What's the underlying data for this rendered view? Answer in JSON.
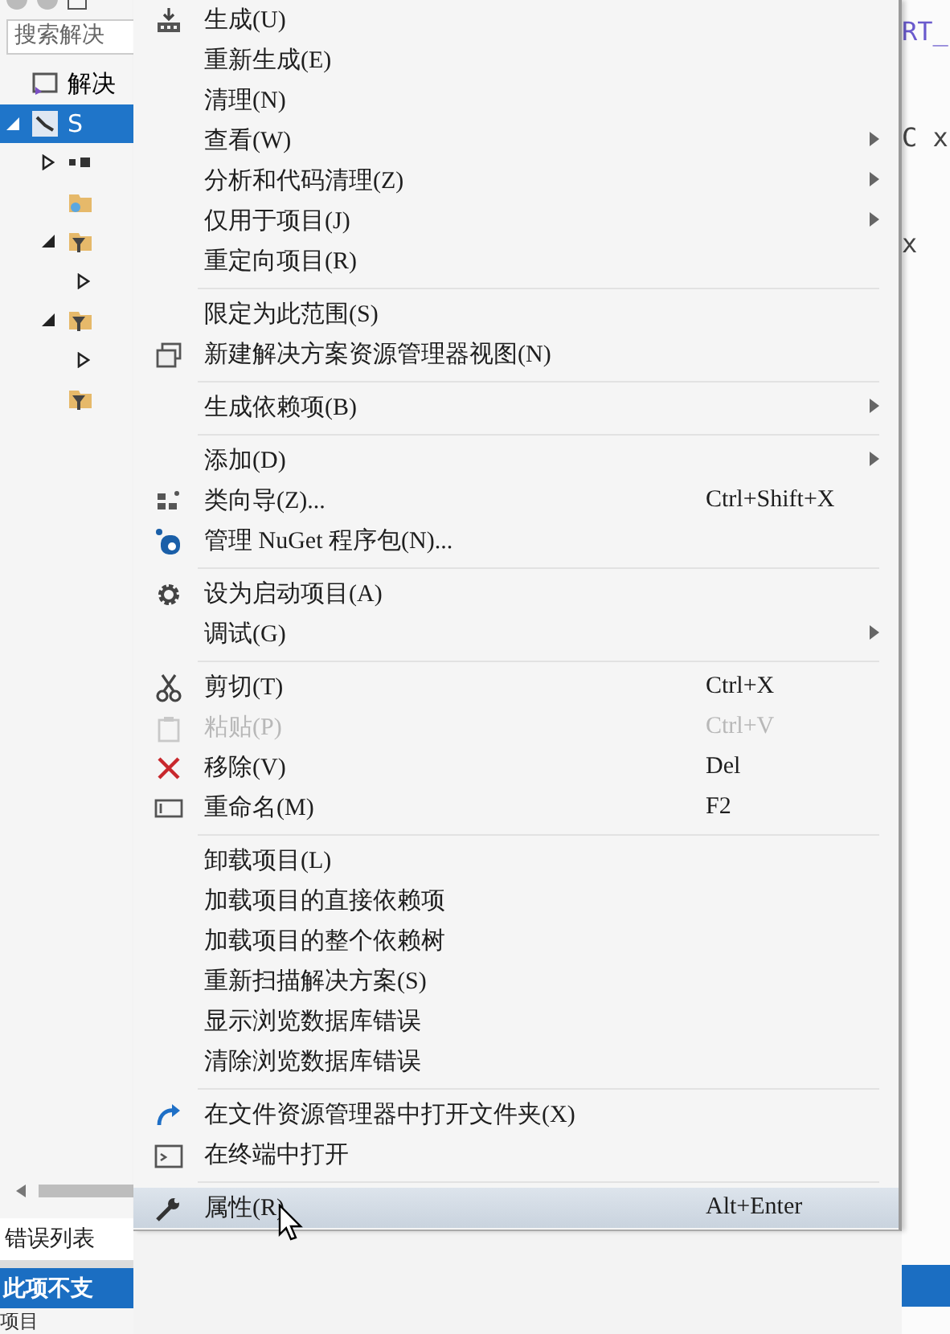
{
  "solution_explorer": {
    "search": {
      "placeholder": "搜索解决"
    },
    "tree": [
      {
        "kind": "solution",
        "label": "解决",
        "selected": false
      },
      {
        "kind": "project",
        "label": "S",
        "selected": true,
        "expanded": true,
        "children": [
          {
            "kind": "reference",
            "selected": false,
            "expanded": false
          },
          {
            "kind": "file",
            "selected": false
          },
          {
            "kind": "filter",
            "selected": false,
            "expanded": true,
            "children": [
              {
                "selected": false,
                "expanded": false
              }
            ]
          },
          {
            "kind": "filter",
            "selected": false,
            "expanded": true,
            "children": [
              {
                "selected": false,
                "expanded": false
              }
            ]
          },
          {
            "kind": "filter",
            "selected": false
          }
        ]
      }
    ],
    "tabs": [
      {
        "label": "错误列表",
        "selected": true
      }
    ],
    "status": "此项不支",
    "footer": "项目"
  },
  "context_menu": {
    "groups": [
      [
        {
          "label": "生成(U)",
          "kind": "build",
          "submenu": false,
          "disabled": false,
          "selected": false
        },
        {
          "label": "重新生成(E)",
          "submenu": false,
          "disabled": false,
          "selected": false
        },
        {
          "label": "清理(N)",
          "submenu": false,
          "disabled": false,
          "selected": false
        },
        {
          "label": "查看(W)",
          "submenu": true,
          "disabled": false,
          "selected": false
        },
        {
          "label": "分析和代码清理(Z)",
          "submenu": true,
          "disabled": false,
          "selected": false
        },
        {
          "label": "仅用于项目(J)",
          "submenu": true,
          "disabled": false,
          "selected": false
        },
        {
          "label": "重定向项目(R)",
          "submenu": false,
          "disabled": false,
          "selected": false
        }
      ],
      [
        {
          "label": "限定为此范围(S)",
          "submenu": false,
          "disabled": false,
          "selected": false
        },
        {
          "label": "新建解决方案资源管理器视图(N)",
          "kind": "windows",
          "submenu": false,
          "disabled": false,
          "selected": false
        }
      ],
      [
        {
          "label": "生成依赖项(B)",
          "submenu": true,
          "disabled": false,
          "selected": false
        }
      ],
      [
        {
          "label": "添加(D)",
          "submenu": true,
          "disabled": false,
          "selected": false
        },
        {
          "label": "类向导(Z)...",
          "kind": "wizard",
          "shortcut": "Ctrl+Shift+X",
          "submenu": false,
          "disabled": false,
          "selected": false
        },
        {
          "label": "管理 NuGet 程序包(N)...",
          "kind": "nuget",
          "submenu": false,
          "disabled": false,
          "selected": false
        }
      ],
      [
        {
          "label": "设为启动项目(A)",
          "kind": "gear",
          "submenu": false,
          "disabled": false,
          "selected": false
        },
        {
          "label": "调试(G)",
          "submenu": true,
          "disabled": false,
          "selected": false
        }
      ],
      [
        {
          "label": "剪切(T)",
          "kind": "cut",
          "shortcut": "Ctrl+X",
          "submenu": false,
          "disabled": false,
          "selected": false
        },
        {
          "label": "粘贴(P)",
          "kind": "paste",
          "shortcut": "Ctrl+V",
          "submenu": false,
          "disabled": true,
          "selected": false
        },
        {
          "label": "移除(V)",
          "kind": "remove",
          "shortcut": "Del",
          "submenu": false,
          "disabled": false,
          "selected": false
        },
        {
          "label": "重命名(M)",
          "kind": "rename",
          "shortcut": "F2",
          "submenu": false,
          "disabled": false,
          "selected": false
        }
      ],
      [
        {
          "label": "卸载项目(L)",
          "submenu": false,
          "disabled": false,
          "selected": false
        },
        {
          "label": "加载项目的直接依赖项",
          "submenu": false,
          "disabled": false,
          "selected": false
        },
        {
          "label": "加载项目的整个依赖树",
          "submenu": false,
          "disabled": false,
          "selected": false
        },
        {
          "label": "重新扫描解决方案(S)",
          "submenu": false,
          "disabled": false,
          "selected": false
        },
        {
          "label": "显示浏览数据库错误",
          "submenu": false,
          "disabled": false,
          "selected": false
        },
        {
          "label": "清除浏览数据库错误",
          "submenu": false,
          "disabled": false,
          "selected": false
        }
      ],
      [
        {
          "label": "在文件资源管理器中打开文件夹(X)",
          "kind": "redo",
          "submenu": false,
          "disabled": false,
          "selected": false
        },
        {
          "label": "在终端中打开",
          "kind": "terminal",
          "submenu": false,
          "disabled": false,
          "selected": false
        }
      ],
      [
        {
          "label": "属性(R)",
          "kind": "wrench",
          "shortcut": "Alt+Enter",
          "submenu": false,
          "disabled": false,
          "selected": true
        }
      ]
    ]
  },
  "editor": {
    "lines": [
      "RT_",
      "C x",
      "x"
    ]
  }
}
